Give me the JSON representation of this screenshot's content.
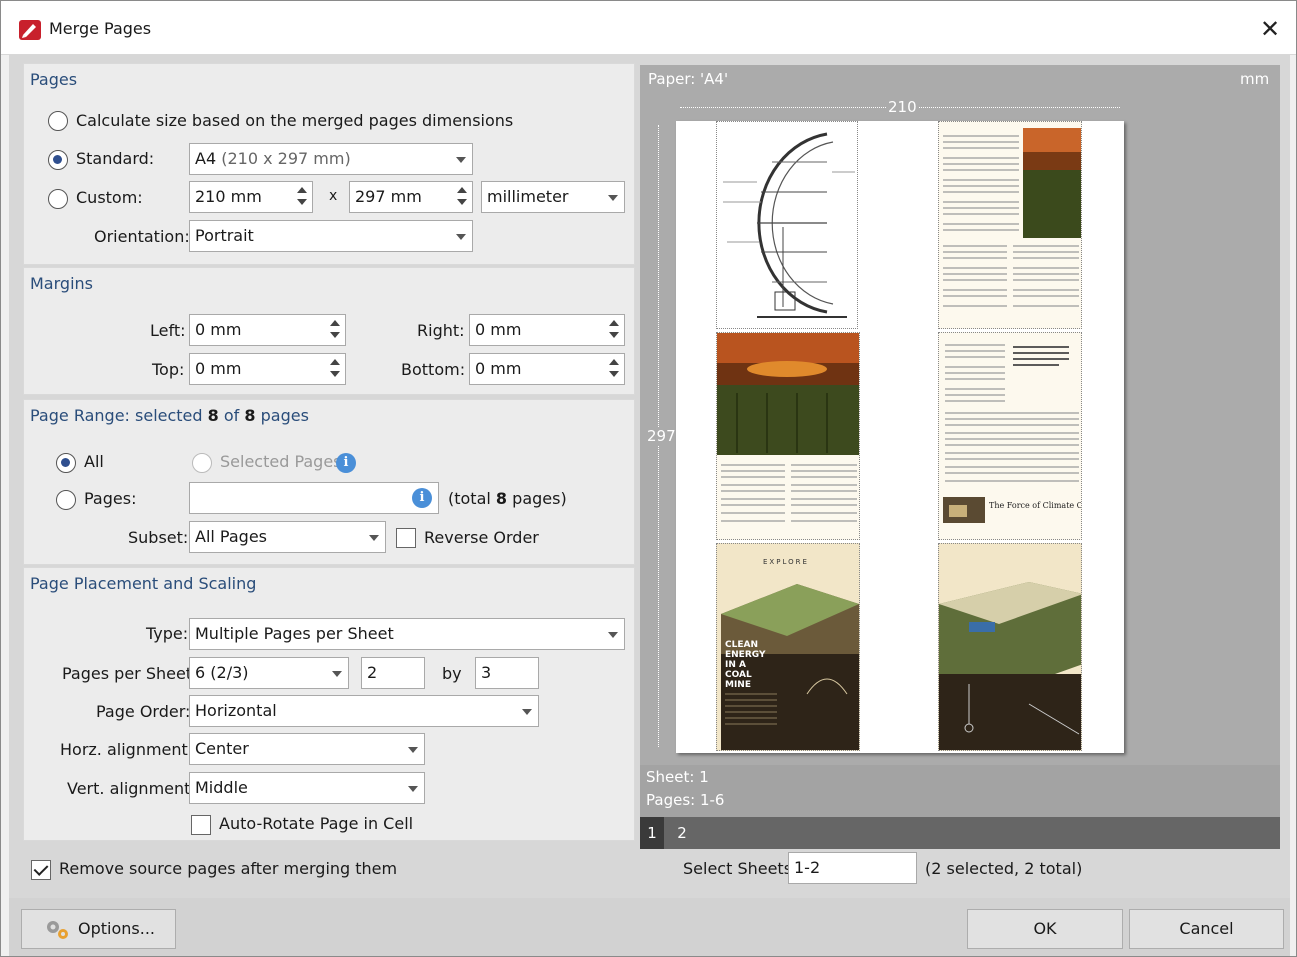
{
  "window": {
    "title": "Merge Pages",
    "close_glyph": "✕"
  },
  "pages": {
    "section_title": "Pages",
    "calc_label": "Calculate size based on the merged pages dimensions",
    "standard_label": "Standard:",
    "standard_value": "A4",
    "standard_detail": "(210 x 297 mm)",
    "custom_label": "Custom:",
    "width_value": "210 mm",
    "x_label": "x",
    "height_value": "297 mm",
    "unit_value": "millimeter",
    "orientation_label": "Orientation:",
    "orientation_value": "Portrait"
  },
  "margins": {
    "section_title": "Margins",
    "left_label": "Left:",
    "left_value": "0 mm",
    "right_label": "Right:",
    "right_value": "0 mm",
    "top_label": "Top:",
    "top_value": "0 mm",
    "bottom_label": "Bottom:",
    "bottom_value": "0 mm"
  },
  "range": {
    "title_pre": "Page Range: selected",
    "selected": "8",
    "title_mid": "of",
    "total": "8",
    "title_post": "pages",
    "all_label": "All",
    "selected_pages_label": "Selected Pages",
    "pages_label": "Pages:",
    "pages_value": "",
    "total_pre": "(total",
    "total_count": "8",
    "total_post": "pages)",
    "subset_label": "Subset:",
    "subset_value": "All Pages",
    "reverse_label": "Reverse Order"
  },
  "placement": {
    "section_title": "Page Placement and Scaling",
    "type_label": "Type:",
    "type_value": "Multiple Pages per Sheet",
    "pps_label": "Pages per Sheet:",
    "pps_value": "6 (2/3)",
    "cols_value": "2",
    "by_label": "by",
    "rows_value": "3",
    "order_label": "Page Order:",
    "order_value": "Horizontal",
    "horz_label": "Horz. alignment:",
    "horz_value": "Center",
    "vert_label": "Vert. alignment:",
    "vert_value": "Middle",
    "autorotate_label": "Auto-Rotate Page in Cell"
  },
  "remove_label": "Remove source pages after merging them",
  "preview": {
    "paper_label": "Paper: 'A4'",
    "unit": "mm",
    "width_dim": "210",
    "height_dim": "297",
    "sheet_label": "Sheet: 1",
    "pages_label": "Pages: 1-6",
    "tabs": [
      "1",
      "2"
    ],
    "explore_text": "EXPLORE",
    "clean_energy_text": "CLEAN ENERGY IN A COAL MINE",
    "climate_text": "The Force of Climate Change"
  },
  "select_sheets": {
    "label": "Select Sheets:",
    "value": "1-2",
    "summary": "(2 selected, 2 total)"
  },
  "buttons": {
    "options": "Options...",
    "ok": "OK",
    "cancel": "Cancel"
  },
  "colors": {
    "accent": "#2a4d7a",
    "preview_bg": "#ababab",
    "info_blue": "#4a8fd8"
  }
}
